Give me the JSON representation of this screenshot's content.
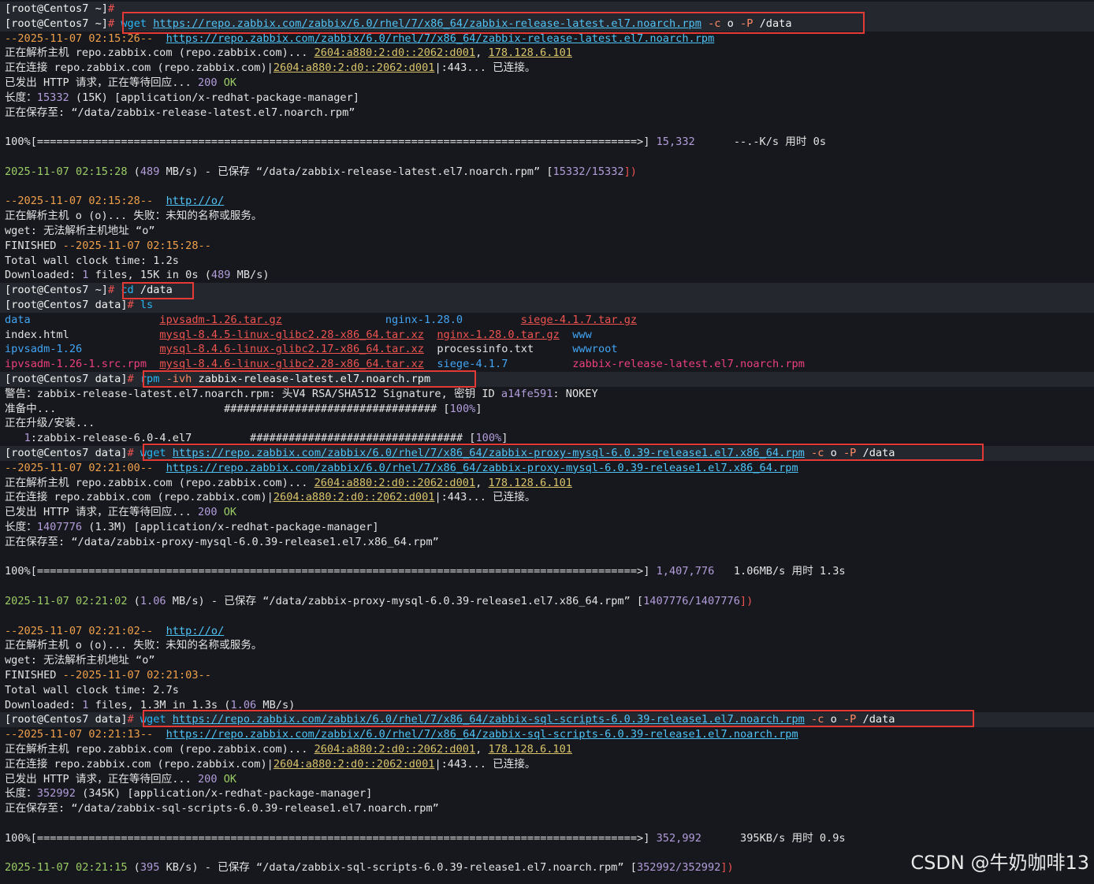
{
  "watermark": "CSDN @牛奶咖啡13",
  "colors": {
    "background": "#16181d",
    "prompt_band": "#24272d",
    "text": "#e3e3e3",
    "url": "#4fc3f7",
    "ip": "#d9c36a",
    "number": "#b39ddb",
    "ok": "#9ccc65",
    "date": "#f0a04b",
    "highlight_box": "#e53935",
    "archive_red": "#ef5350",
    "directory_blue": "#42a5f5"
  },
  "lines": [
    {
      "prompt": true,
      "spans": [
        {
          "c": "c-white",
          "t": "[root@Centos7 ~]"
        },
        {
          "c": "c-red",
          "t": "#"
        }
      ]
    },
    {
      "prompt": true,
      "spans": [
        {
          "c": "c-white",
          "t": "[root@Centos7 ~]"
        },
        {
          "c": "c-red",
          "t": "# "
        },
        {
          "c": "c-cmd",
          "t": "wget "
        },
        {
          "c": "c-url",
          "t": "https://repo.zabbix.com/zabbix/6.0/rhel/7/x86_64/zabbix-release-latest.el7.noarch.rpm"
        },
        {
          "c": "c-flag",
          "t": " -c"
        },
        {
          "c": "c-white",
          "t": " o"
        },
        {
          "c": "c-flag",
          "t": " -P"
        },
        {
          "c": "c-white",
          "t": " /data"
        }
      ]
    },
    {
      "spans": [
        {
          "c": "c-date",
          "t": "--2025-11-07 02:15:26--  "
        },
        {
          "c": "c-url",
          "t": "https://repo.zabbix.com/zabbix/6.0/rhel/7/x86_64/zabbix-release-latest.el7.noarch.rpm"
        }
      ]
    },
    {
      "spans": [
        {
          "c": "c-def",
          "t": "正在解析主机 repo.zabbix.com (repo.zabbix.com)... "
        },
        {
          "c": "c-ip",
          "t": "2604:a880:2:d0::2062:d001"
        },
        {
          "c": "c-def",
          "t": ", "
        },
        {
          "c": "c-ip",
          "t": "178.128.6.101"
        }
      ]
    },
    {
      "spans": [
        {
          "c": "c-def",
          "t": "正在连接 repo.zabbix.com (repo.zabbix.com)|"
        },
        {
          "c": "c-ip",
          "t": "2604:a880:2:d0::2062:d001"
        },
        {
          "c": "c-def",
          "t": "|:443... 已连接。"
        }
      ]
    },
    {
      "spans": [
        {
          "c": "c-def",
          "t": "已发出 HTTP 请求，正在等待回应... "
        },
        {
          "c": "c-num",
          "t": "200"
        },
        {
          "c": "c-ok",
          "t": " OK"
        }
      ]
    },
    {
      "spans": [
        {
          "c": "c-def",
          "t": "长度："
        },
        {
          "c": "c-num",
          "t": "15332"
        },
        {
          "c": "c-def",
          "t": " (15K) [application/x-redhat-package-manager]"
        }
      ]
    },
    {
      "spans": [
        {
          "c": "c-def",
          "t": "正在保存至: “/data/zabbix-release-latest.el7.noarch.rpm”"
        }
      ]
    },
    {
      "spans": []
    },
    {
      "spans": [
        {
          "c": "c-def",
          "t": "100%[=============================================================================================>] "
        },
        {
          "c": "c-num",
          "t": "15,332"
        },
        {
          "c": "c-def",
          "t": "      --.-K/s 用时 0s"
        }
      ]
    },
    {
      "spans": []
    },
    {
      "spans": [
        {
          "c": "c-ok",
          "t": "2025-11-07 02:15:28"
        },
        {
          "c": "c-def",
          "t": " ("
        },
        {
          "c": "c-num",
          "t": "489"
        },
        {
          "c": "c-def",
          "t": " MB/s) - 已保存 “/data/zabbix-release-latest.el7.noarch.rpm” ["
        },
        {
          "c": "c-num",
          "t": "15332/15332"
        },
        {
          "c": "c-red",
          "t": "])"
        }
      ]
    },
    {
      "spans": []
    },
    {
      "spans": [
        {
          "c": "c-date",
          "t": "--2025-11-07 02:15:28--  "
        },
        {
          "c": "c-url",
          "t": "http://o/"
        }
      ]
    },
    {
      "spans": [
        {
          "c": "c-def",
          "t": "正在解析主机 o (o)... 失败：未知的名称或服务。"
        }
      ]
    },
    {
      "spans": [
        {
          "c": "c-def",
          "t": "wget: 无法解析主机地址 “o”"
        }
      ]
    },
    {
      "spans": [
        {
          "c": "c-def",
          "t": "FINISHED "
        },
        {
          "c": "c-date",
          "t": "--2025-11-07 02:15:28--"
        }
      ]
    },
    {
      "spans": [
        {
          "c": "c-def",
          "t": "Total wall clock time: 1.2s"
        }
      ]
    },
    {
      "spans": [
        {
          "c": "c-def",
          "t": "Downloaded: "
        },
        {
          "c": "c-num",
          "t": "1"
        },
        {
          "c": "c-def",
          "t": " files, 15K in 0s ("
        },
        {
          "c": "c-num",
          "t": "489"
        },
        {
          "c": "c-def",
          "t": " MB/s)"
        }
      ]
    },
    {
      "prompt": true,
      "spans": [
        {
          "c": "c-white",
          "t": "[root@Centos7 ~]"
        },
        {
          "c": "c-red",
          "t": "# "
        },
        {
          "c": "c-cmd",
          "t": "cd"
        },
        {
          "c": "c-white",
          "t": " /data"
        }
      ]
    },
    {
      "prompt": true,
      "spans": [
        {
          "c": "c-white",
          "t": "[root@Centos7 data]"
        },
        {
          "c": "c-red",
          "t": "# "
        },
        {
          "c": "c-cmd",
          "t": "ls"
        }
      ]
    },
    {
      "spans": [
        {
          "c": "c-blue",
          "t": "data                    "
        },
        {
          "c": "c-red-u",
          "t": "ipvsadm-1.26.tar.gz"
        },
        {
          "c": "c-def",
          "t": "                "
        },
        {
          "c": "c-blue",
          "t": "nginx-1.28.0"
        },
        {
          "c": "c-def",
          "t": "         "
        },
        {
          "c": "c-red-u",
          "t": "siege-4.1.7.tar.gz"
        }
      ]
    },
    {
      "spans": [
        {
          "c": "c-def",
          "t": "index.html              "
        },
        {
          "c": "c-red-u",
          "t": "mysql-8.4.5-linux-glibc2.28-x86_64.tar.xz"
        },
        {
          "c": "c-def",
          "t": "  "
        },
        {
          "c": "c-red-u",
          "t": "nginx-1.28.0.tar.gz"
        },
        {
          "c": "c-def",
          "t": "  "
        },
        {
          "c": "c-blue",
          "t": "www"
        }
      ]
    },
    {
      "spans": [
        {
          "c": "c-blue",
          "t": "ipvsadm-1.26"
        },
        {
          "c": "c-def",
          "t": "            "
        },
        {
          "c": "c-red-u",
          "t": "mysql-8.4.6-linux-glibc2.17-x86_64.tar.xz"
        },
        {
          "c": "c-def",
          "t": "  processinfo.txt      "
        },
        {
          "c": "c-blue",
          "t": "wwwroot"
        }
      ]
    },
    {
      "spans": [
        {
          "c": "c-pink",
          "t": "ipvsadm-1.26-1.src.rpm"
        },
        {
          "c": "c-def",
          "t": "  "
        },
        {
          "c": "c-red-u",
          "t": "mysql-8.4.6-linux-glibc2.28-x86_64.tar.xz"
        },
        {
          "c": "c-def",
          "t": "  "
        },
        {
          "c": "c-blue",
          "t": "siege-4.1.7"
        },
        {
          "c": "c-def",
          "t": "          "
        },
        {
          "c": "c-pink",
          "t": "zabbix-release-latest.el7.noarch.rpm"
        }
      ]
    },
    {
      "prompt": true,
      "spans": [
        {
          "c": "c-white",
          "t": "[root@Centos7 data]"
        },
        {
          "c": "c-red",
          "t": "# "
        },
        {
          "c": "c-cmd",
          "t": "rpm"
        },
        {
          "c": "c-flag",
          "t": " -ivh"
        },
        {
          "c": "c-white",
          "t": " zabbix-release-latest.el7.noarch.rpm"
        }
      ]
    },
    {
      "spans": [
        {
          "c": "c-def",
          "t": "警告：zabbix-release-latest.el7.noarch.rpm: 头V4 RSA/SHA512 Signature, 密钥 ID "
        },
        {
          "c": "c-num",
          "t": "a14fe591"
        },
        {
          "c": "c-def",
          "t": ": NOKEY"
        }
      ]
    },
    {
      "spans": [
        {
          "c": "c-def",
          "t": "准备中...                          ################################# ["
        },
        {
          "c": "c-num",
          "t": "100%"
        },
        {
          "c": "c-def",
          "t": "]"
        }
      ]
    },
    {
      "spans": [
        {
          "c": "c-def",
          "t": "正在升级/安装..."
        }
      ]
    },
    {
      "spans": [
        {
          "c": "c-def",
          "t": "   "
        },
        {
          "c": "c-num",
          "t": "1"
        },
        {
          "c": "c-def",
          "t": ":zabbix-release-6.0-4.el7         ################################# ["
        },
        {
          "c": "c-num",
          "t": "100%"
        },
        {
          "c": "c-def",
          "t": "]"
        }
      ]
    },
    {
      "prompt": true,
      "spans": [
        {
          "c": "c-white",
          "t": "[root@Centos7 data]"
        },
        {
          "c": "c-red",
          "t": "# "
        },
        {
          "c": "c-cmd",
          "t": "wget "
        },
        {
          "c": "c-url",
          "t": "https://repo.zabbix.com/zabbix/6.0/rhel/7/x86_64/zabbix-proxy-mysql-6.0.39-release1.el7.x86_64.rpm"
        },
        {
          "c": "c-flag",
          "t": " -c"
        },
        {
          "c": "c-white",
          "t": " o"
        },
        {
          "c": "c-flag",
          "t": " -P"
        },
        {
          "c": "c-white",
          "t": " /data"
        }
      ]
    },
    {
      "spans": [
        {
          "c": "c-date",
          "t": "--2025-11-07 02:21:00--  "
        },
        {
          "c": "c-url",
          "t": "https://repo.zabbix.com/zabbix/6.0/rhel/7/x86_64/zabbix-proxy-mysql-6.0.39-release1.el7.x86_64.rpm"
        }
      ]
    },
    {
      "spans": [
        {
          "c": "c-def",
          "t": "正在解析主机 repo.zabbix.com (repo.zabbix.com)... "
        },
        {
          "c": "c-ip",
          "t": "2604:a880:2:d0::2062:d001"
        },
        {
          "c": "c-def",
          "t": ", "
        },
        {
          "c": "c-ip",
          "t": "178.128.6.101"
        }
      ]
    },
    {
      "spans": [
        {
          "c": "c-def",
          "t": "正在连接 repo.zabbix.com (repo.zabbix.com)|"
        },
        {
          "c": "c-ip",
          "t": "2604:a880:2:d0::2062:d001"
        },
        {
          "c": "c-def",
          "t": "|:443... 已连接。"
        }
      ]
    },
    {
      "spans": [
        {
          "c": "c-def",
          "t": "已发出 HTTP 请求，正在等待回应... "
        },
        {
          "c": "c-num",
          "t": "200"
        },
        {
          "c": "c-ok",
          "t": " OK"
        }
      ]
    },
    {
      "spans": [
        {
          "c": "c-def",
          "t": "长度："
        },
        {
          "c": "c-num",
          "t": "1407776"
        },
        {
          "c": "c-def",
          "t": " (1.3M) [application/x-redhat-package-manager]"
        }
      ]
    },
    {
      "spans": [
        {
          "c": "c-def",
          "t": "正在保存至: “/data/zabbix-proxy-mysql-6.0.39-release1.el7.x86_64.rpm”"
        }
      ]
    },
    {
      "spans": []
    },
    {
      "spans": [
        {
          "c": "c-def",
          "t": "100%[=============================================================================================>] "
        },
        {
          "c": "c-num",
          "t": "1,407,776"
        },
        {
          "c": "c-def",
          "t": "   1.06MB/s 用时 1.3s"
        }
      ]
    },
    {
      "spans": []
    },
    {
      "spans": [
        {
          "c": "c-ok",
          "t": "2025-11-07 02:21:02"
        },
        {
          "c": "c-def",
          "t": " ("
        },
        {
          "c": "c-num",
          "t": "1.06"
        },
        {
          "c": "c-def",
          "t": " MB/s) - 已保存 “/data/zabbix-proxy-mysql-6.0.39-release1.el7.x86_64.rpm” ["
        },
        {
          "c": "c-num",
          "t": "1407776/1407776"
        },
        {
          "c": "c-red",
          "t": "])"
        }
      ]
    },
    {
      "spans": []
    },
    {
      "spans": [
        {
          "c": "c-date",
          "t": "--2025-11-07 02:21:02--  "
        },
        {
          "c": "c-url",
          "t": "http://o/"
        }
      ]
    },
    {
      "spans": [
        {
          "c": "c-def",
          "t": "正在解析主机 o (o)... 失败：未知的名称或服务。"
        }
      ]
    },
    {
      "spans": [
        {
          "c": "c-def",
          "t": "wget: 无法解析主机地址 “o”"
        }
      ]
    },
    {
      "spans": [
        {
          "c": "c-def",
          "t": "FINISHED "
        },
        {
          "c": "c-date",
          "t": "--2025-11-07 02:21:03--"
        }
      ]
    },
    {
      "spans": [
        {
          "c": "c-def",
          "t": "Total wall clock time: 2.7s"
        }
      ]
    },
    {
      "spans": [
        {
          "c": "c-def",
          "t": "Downloaded: "
        },
        {
          "c": "c-num",
          "t": "1"
        },
        {
          "c": "c-def",
          "t": " files, 1.3M in 1.3s ("
        },
        {
          "c": "c-num",
          "t": "1.06"
        },
        {
          "c": "c-def",
          "t": " MB/s)"
        }
      ]
    },
    {
      "prompt": true,
      "spans": [
        {
          "c": "c-white",
          "t": "[root@Centos7 data]"
        },
        {
          "c": "c-red",
          "t": "# "
        },
        {
          "c": "c-cmd",
          "t": "wget "
        },
        {
          "c": "c-url",
          "t": "https://repo.zabbix.com/zabbix/6.0/rhel/7/x86_64/zabbix-sql-scripts-6.0.39-release1.el7.noarch.rpm"
        },
        {
          "c": "c-flag",
          "t": " -c"
        },
        {
          "c": "c-white",
          "t": " o"
        },
        {
          "c": "c-flag",
          "t": " -P"
        },
        {
          "c": "c-white",
          "t": " /data"
        }
      ]
    },
    {
      "spans": [
        {
          "c": "c-date",
          "t": "--2025-11-07 02:21:13--  "
        },
        {
          "c": "c-url",
          "t": "https://repo.zabbix.com/zabbix/6.0/rhel/7/x86_64/zabbix-sql-scripts-6.0.39-release1.el7.noarch.rpm"
        }
      ]
    },
    {
      "spans": [
        {
          "c": "c-def",
          "t": "正在解析主机 repo.zabbix.com (repo.zabbix.com)... "
        },
        {
          "c": "c-ip",
          "t": "2604:a880:2:d0::2062:d001"
        },
        {
          "c": "c-def",
          "t": ", "
        },
        {
          "c": "c-ip",
          "t": "178.128.6.101"
        }
      ]
    },
    {
      "spans": [
        {
          "c": "c-def",
          "t": "正在连接 repo.zabbix.com (repo.zabbix.com)|"
        },
        {
          "c": "c-ip",
          "t": "2604:a880:2:d0::2062:d001"
        },
        {
          "c": "c-def",
          "t": "|:443... 已连接。"
        }
      ]
    },
    {
      "spans": [
        {
          "c": "c-def",
          "t": "已发出 HTTP 请求，正在等待回应... "
        },
        {
          "c": "c-num",
          "t": "200"
        },
        {
          "c": "c-ok",
          "t": " OK"
        }
      ]
    },
    {
      "spans": [
        {
          "c": "c-def",
          "t": "长度："
        },
        {
          "c": "c-num",
          "t": "352992"
        },
        {
          "c": "c-def",
          "t": " (345K) [application/x-redhat-package-manager]"
        }
      ]
    },
    {
      "spans": [
        {
          "c": "c-def",
          "t": "正在保存至: “/data/zabbix-sql-scripts-6.0.39-release1.el7.noarch.rpm”"
        }
      ]
    },
    {
      "spans": []
    },
    {
      "spans": [
        {
          "c": "c-def",
          "t": "100%[=============================================================================================>] "
        },
        {
          "c": "c-num",
          "t": "352,992"
        },
        {
          "c": "c-def",
          "t": "      395KB/s 用时 0.9s"
        }
      ]
    },
    {
      "spans": []
    },
    {
      "spans": [
        {
          "c": "c-ok",
          "t": "2025-11-07 02:21:15"
        },
        {
          "c": "c-def",
          "t": " ("
        },
        {
          "c": "c-num",
          "t": "395"
        },
        {
          "c": "c-def",
          "t": " KB/s) - 已保存 “/data/zabbix-sql-scripts-6.0.39-release1.el7.noarch.rpm” ["
        },
        {
          "c": "c-num",
          "t": "352992/352992"
        },
        {
          "c": "c-red",
          "t": "])"
        }
      ]
    }
  ]
}
